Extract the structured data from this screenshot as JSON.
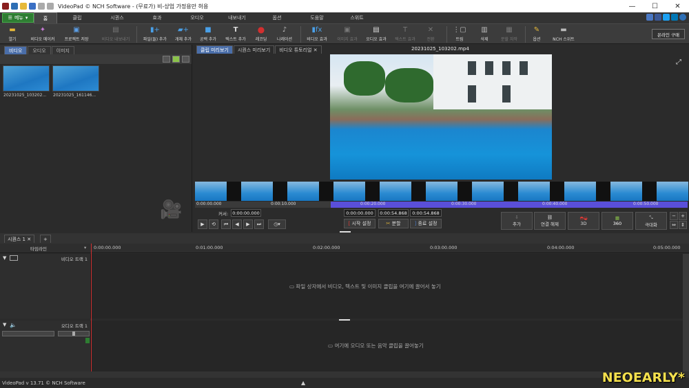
{
  "window": {
    "title": "VideoPad © NCH Software - (무료가) 비-상업 가정용만 허용",
    "controls": [
      "—",
      "☐",
      "✕"
    ]
  },
  "menu": {
    "button_label": "메뉴",
    "tabs": [
      "홈",
      "클립",
      "시퀀스",
      "효과",
      "오디오",
      "내보내기",
      "옵션",
      "도움말",
      "스위트"
    ],
    "active_tab": "홈"
  },
  "toolbar": {
    "items": [
      {
        "label": "열기",
        "icon": "folder-icon"
      },
      {
        "label": "비디오 메이커",
        "icon": "wizard-icon"
      },
      {
        "label": "프로젝트 저장",
        "icon": "save-icon"
      },
      {
        "label": "비디오 내보내기",
        "icon": "export-icon"
      },
      {
        "label": "파일(들) 추가",
        "icon": "add-files-icon"
      },
      {
        "label": "개체 추가",
        "icon": "add-objects-icon"
      },
      {
        "label": "공백 추가",
        "icon": "add-blank-icon"
      },
      {
        "label": "텍스트 추가",
        "icon": "add-text-icon"
      },
      {
        "label": "레코딩",
        "icon": "record-icon"
      },
      {
        "label": "나레이션",
        "icon": "narrate-icon"
      },
      {
        "label": "비디오 효과",
        "icon": "video-effects-icon"
      },
      {
        "label": "이미지 효과",
        "icon": "image-effects-icon"
      },
      {
        "label": "오디오 효과",
        "icon": "audio-effects-icon"
      },
      {
        "label": "텍스트 효과",
        "icon": "text-effects-icon"
      },
      {
        "label": "전환",
        "icon": "transition-icon"
      },
      {
        "label": "트림",
        "icon": "trim-icon"
      },
      {
        "label": "삭제",
        "icon": "delete-icon"
      },
      {
        "label": "분할 자막",
        "icon": "subtitle-icon"
      },
      {
        "label": "옵션",
        "icon": "options-icon"
      },
      {
        "label": "NCH 스위트",
        "icon": "nch-suite-icon"
      }
    ],
    "buy_label": "온라인 구매"
  },
  "bin": {
    "tabs": [
      "비디오",
      "오디오",
      "이미지"
    ],
    "active_tab": "비디오",
    "files": [
      "20231025_103202...",
      "20231025_161146..."
    ]
  },
  "preview": {
    "tabs": [
      "클립 미리보기",
      "시퀀스 미리보기",
      "비디오 튜토리얼"
    ],
    "active_tab": "클립 미리보기",
    "clip_title": "20231025_103202.mp4",
    "ruler_ticks": [
      "0:00:00.000",
      "0:00:10.000",
      "0:00:20.000",
      "0:00:30.000",
      "0:00:40.000",
      "0:00:50.000"
    ],
    "cursor_label": "커서:",
    "cursor_value": "0:00:00.000",
    "in_point": "0:00:00.000",
    "duration": "0:00:54.868",
    "out_point": "0:00:54.868",
    "set_start_label": "시작 설정",
    "split_label": "분할",
    "set_end_label": "종료 설정",
    "add_label": "추가",
    "unlink_label": "연결 해제",
    "threed_label": "3D",
    "threesixty_label": "360",
    "maximize_label": "극대화"
  },
  "sequence": {
    "tab_label": "시퀀스 1",
    "tab_count": "1",
    "timeline_label": "타임라인",
    "ticks": [
      "0:00:00.000",
      "0:01:00.000",
      "0:02:00.000",
      "0:03:00.000",
      "0:04:00.000",
      "0:05:00.000"
    ],
    "video_track_label": "비디오 트랙 1",
    "audio_track_label": "오디오 트랙 1",
    "video_hint": "파일 상자에서 비디오, 텍스트 및 이미지 클립을 여기에 끌어서 놓기",
    "audio_hint": "여기에 오디오 또는 음악 클립을 끌어놓기"
  },
  "status": {
    "version": "VideoPad v 13.71 © NCH Software"
  },
  "watermark": "NEOEARLY*",
  "colors": {
    "accent_blue": "#4a6ea9",
    "selection_purple": "#5a4fd9",
    "playhead_red": "#d32f2f",
    "menu_green": "#2e7d32"
  }
}
